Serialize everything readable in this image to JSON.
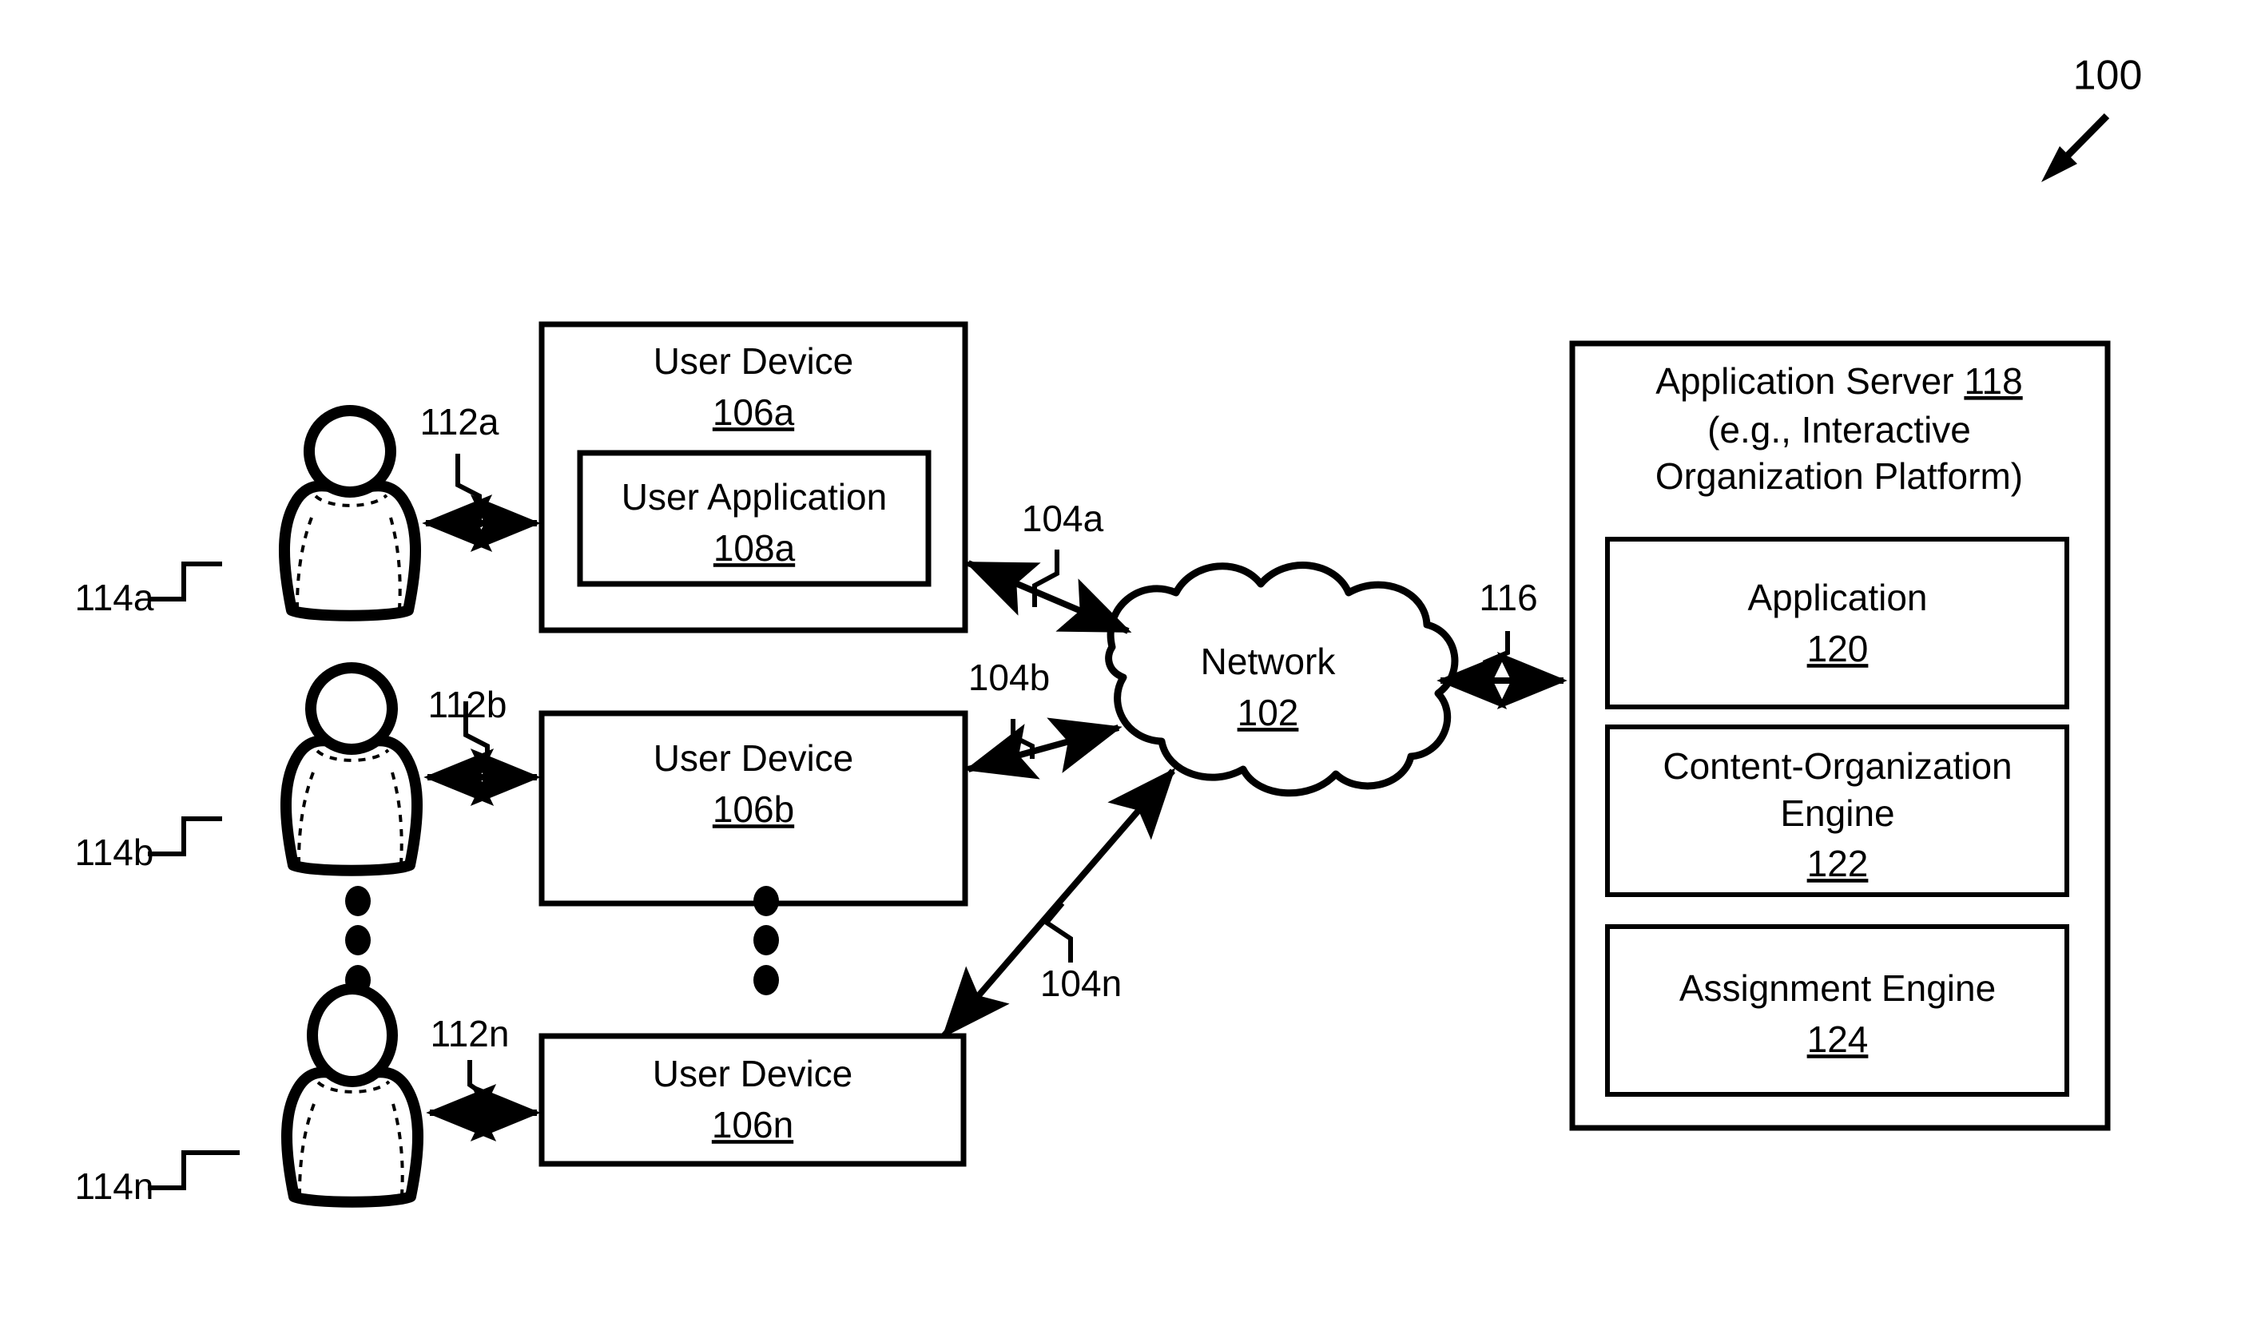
{
  "figure": {
    "number": "100",
    "arrow_icon": "figure-callout-arrow"
  },
  "users": [
    {
      "id": "a",
      "person_ref": "114a",
      "link_ref": "112a",
      "icon": "user-person-icon"
    },
    {
      "id": "b",
      "person_ref": "114b",
      "link_ref": "112b",
      "icon": "user-person-icon"
    },
    {
      "id": "n",
      "person_ref": "114n",
      "link_ref": "112n",
      "icon": "user-person-icon"
    }
  ],
  "user_devices": [
    {
      "title": "User Device",
      "ref": "106a",
      "inner": {
        "title": "User Application",
        "ref": "108a"
      },
      "network_link_ref": "104a"
    },
    {
      "title": "User Device",
      "ref": "106b",
      "inner": null,
      "network_link_ref": "104b"
    },
    {
      "title": "User Device",
      "ref": "106n",
      "inner": null,
      "network_link_ref": "104n"
    }
  ],
  "network": {
    "title": "Network",
    "ref": "102",
    "shape": "cloud"
  },
  "server": {
    "title": "Application Server",
    "ref": "118",
    "subtitle_line1": "(e.g., Interactive",
    "subtitle_line2": "Organization Platform)",
    "link_ref": "116",
    "components": [
      {
        "title_line1": "Application",
        "title_line2": "",
        "ref": "120"
      },
      {
        "title_line1": "Content-Organization",
        "title_line2": "Engine",
        "ref": "122"
      },
      {
        "title_line1": "Assignment Engine",
        "title_line2": "",
        "ref": "124"
      }
    ]
  },
  "ellipses": {
    "users_column": "vertical-ellipsis",
    "devices_column": "vertical-ellipsis",
    "dot_count": 3
  },
  "colors": {
    "line": "#000000",
    "fill": "#ffffff",
    "text": "#000000"
  }
}
